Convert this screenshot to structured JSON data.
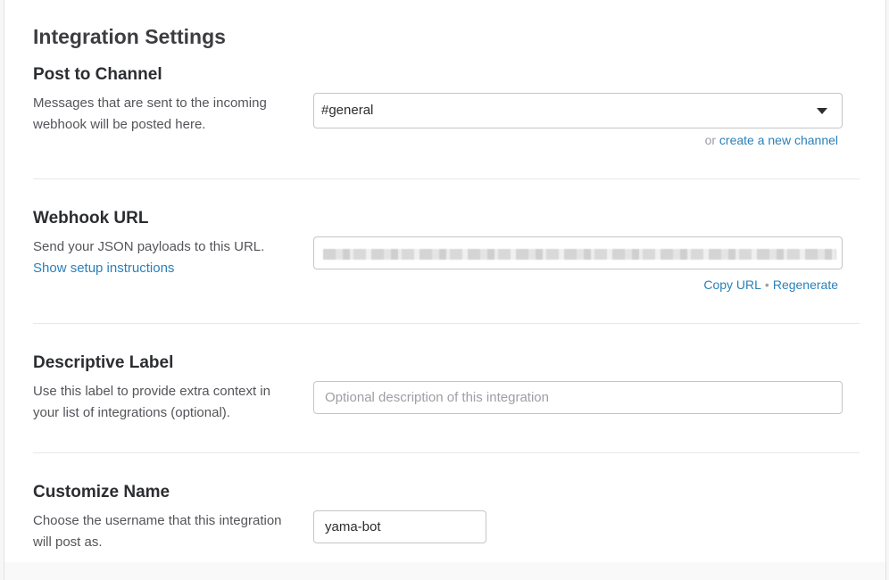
{
  "page": {
    "title": "Integration Settings"
  },
  "post_to_channel": {
    "heading": "Post to Channel",
    "description": "Messages that are sent to the incoming webhook will be posted here.",
    "selected_channel": "#general",
    "or_text": "or",
    "create_link": "create a new channel"
  },
  "webhook_url": {
    "heading": "Webhook URL",
    "description": "Send your JSON payloads to this URL.",
    "setup_link": "Show setup instructions",
    "copy_link": "Copy URL",
    "separator": "•",
    "regenerate_link": "Regenerate"
  },
  "descriptive_label": {
    "heading": "Descriptive Label",
    "description": "Use this label to provide extra context in your list of integrations (optional).",
    "placeholder": "Optional description of this integration",
    "value": ""
  },
  "customize_name": {
    "heading": "Customize Name",
    "description": "Choose the username that this integration will post as.",
    "value": "yama-bot"
  },
  "colors": {
    "link": "#2a80b9",
    "muted": "#9e9ea6",
    "border": "#c5c5c5"
  }
}
